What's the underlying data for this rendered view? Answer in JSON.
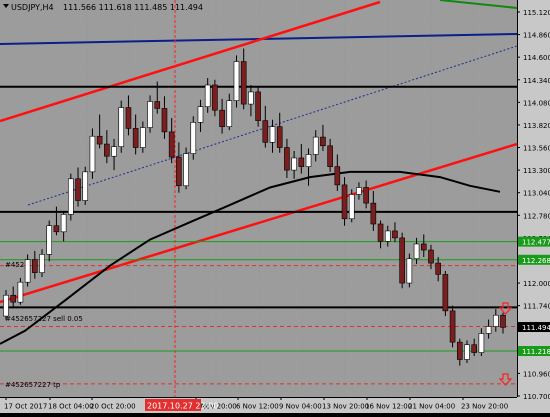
{
  "symbol": {
    "title": "USDJPY,H4",
    "ohlc": "111.566 111.618 111.485 111.494"
  },
  "price_axis": {
    "min": 110.7,
    "max": 115.12,
    "ticks": [
      "115.120",
      "114.860",
      "114.600",
      "114.340",
      "114.080",
      "113.820",
      "113.560",
      "113.300",
      "113.040",
      "112.780",
      "112.520",
      "112.260",
      "112.000",
      "111.740",
      "111.480",
      "111.220",
      "110.960",
      "110.700"
    ]
  },
  "time_axis": {
    "labels": [
      "17 Oct 2017",
      "18 Oct 04:00",
      "20 Oct 20:00",
      "1 Nov 20:00",
      "6 Nov 12:00",
      "9 Nov 04:00",
      "13 Nov 20:00",
      "16 Nov 12:00",
      "21 Nov 04:00",
      "23 Nov 20:00"
    ],
    "crosshair_label": "2017.10.27 23:00"
  },
  "price_tags": [
    {
      "text": "112.477",
      "value": 112.477,
      "color": "#1a9a1a"
    },
    {
      "text": "112.268",
      "value": 112.268,
      "color": "#1a9a1a"
    },
    {
      "text": "111.494",
      "value": 111.494,
      "color": "#000000"
    },
    {
      "text": "111.218",
      "value": 111.218,
      "color": "#1a9a1a"
    }
  ],
  "order_labels": [
    {
      "text": "#452",
      "value": 112.22
    },
    {
      "text": "#452657227 sell 0.05",
      "value": 111.6
    },
    {
      "text": "#452657227 tp",
      "value": 110.84
    }
  ],
  "chart_data": {
    "type": "candlestick",
    "title": "USDJPY,H4",
    "ylim": [
      110.7,
      115.12
    ],
    "horizontal_lines": {
      "black": [
        114.26,
        112.82,
        111.72
      ],
      "green": [
        112.477,
        112.268,
        111.218
      ],
      "red_dashed": [
        112.2,
        111.5,
        110.84
      ]
    },
    "moving_average_black": [
      [
        0,
        111.3
      ],
      [
        25,
        111.45
      ],
      [
        65,
        111.8
      ],
      [
        110,
        112.2
      ],
      [
        150,
        112.5
      ],
      [
        190,
        112.7
      ],
      [
        230,
        112.9
      ],
      [
        270,
        113.1
      ],
      [
        310,
        113.22
      ],
      [
        350,
        113.28
      ],
      [
        400,
        113.28
      ],
      [
        440,
        113.22
      ],
      [
        470,
        113.12
      ],
      [
        500,
        113.05
      ]
    ],
    "candles": [
      [
        111.62,
        111.92,
        111.58,
        111.86
      ],
      [
        111.86,
        111.96,
        111.72,
        111.78
      ],
      [
        111.78,
        112.06,
        111.75,
        112.01
      ],
      [
        112.01,
        112.33,
        111.96,
        112.27
      ],
      [
        112.27,
        112.37,
        112.05,
        112.12
      ],
      [
        112.12,
        112.39,
        112.07,
        112.33
      ],
      [
        112.33,
        112.72,
        112.25,
        112.66
      ],
      [
        112.66,
        112.88,
        112.55,
        112.59
      ],
      [
        112.59,
        112.83,
        112.48,
        112.79
      ],
      [
        112.79,
        113.26,
        112.72,
        113.2
      ],
      [
        113.2,
        113.33,
        112.88,
        112.95
      ],
      [
        112.95,
        113.34,
        112.9,
        113.28
      ],
      [
        113.28,
        113.78,
        113.2,
        113.69
      ],
      [
        113.69,
        113.94,
        113.55,
        113.6
      ],
      [
        113.6,
        113.76,
        113.38,
        113.46
      ],
      [
        113.46,
        113.66,
        113.3,
        113.57
      ],
      [
        113.57,
        114.1,
        113.5,
        114.02
      ],
      [
        114.02,
        114.16,
        113.7,
        113.78
      ],
      [
        113.78,
        113.94,
        113.48,
        113.56
      ],
      [
        113.56,
        113.86,
        113.5,
        113.79
      ],
      [
        113.79,
        114.16,
        113.73,
        114.09
      ],
      [
        114.09,
        114.32,
        113.95,
        114.01
      ],
      [
        114.01,
        114.15,
        113.66,
        113.74
      ],
      [
        113.74,
        113.9,
        113.38,
        113.45
      ],
      [
        113.45,
        113.62,
        113.04,
        113.12
      ],
      [
        113.12,
        113.56,
        113.08,
        113.49
      ],
      [
        113.49,
        113.92,
        113.42,
        113.85
      ],
      [
        113.85,
        114.11,
        113.74,
        114.03
      ],
      [
        114.03,
        114.36,
        113.96,
        114.28
      ],
      [
        114.28,
        114.34,
        113.92,
        113.99
      ],
      [
        113.99,
        114.12,
        113.72,
        113.8
      ],
      [
        113.8,
        114.18,
        113.76,
        114.1
      ],
      [
        114.1,
        114.62,
        114.02,
        114.55
      ],
      [
        114.55,
        114.7,
        114.0,
        114.06
      ],
      [
        114.06,
        114.28,
        113.92,
        114.2
      ],
      [
        114.2,
        114.26,
        113.8,
        113.87
      ],
      [
        113.87,
        114.04,
        113.56,
        113.62
      ],
      [
        113.62,
        113.88,
        113.5,
        113.8
      ],
      [
        113.8,
        113.96,
        113.5,
        113.56
      ],
      [
        113.56,
        113.66,
        113.21,
        113.3
      ],
      [
        113.3,
        113.52,
        113.2,
        113.44
      ],
      [
        113.44,
        113.6,
        113.26,
        113.34
      ],
      [
        113.34,
        113.55,
        113.12,
        113.48
      ],
      [
        113.48,
        113.76,
        113.4,
        113.68
      ],
      [
        113.68,
        113.82,
        113.52,
        113.58
      ],
      [
        113.58,
        113.66,
        113.28,
        113.34
      ],
      [
        113.34,
        113.48,
        113.06,
        113.13
      ],
      [
        113.13,
        113.22,
        112.66,
        112.74
      ],
      [
        112.74,
        113.08,
        112.7,
        113.02
      ],
      [
        113.02,
        113.16,
        112.96,
        113.1
      ],
      [
        113.1,
        113.18,
        112.86,
        112.92
      ],
      [
        112.92,
        113.06,
        112.6,
        112.68
      ],
      [
        112.68,
        112.72,
        112.4,
        112.48
      ],
      [
        112.48,
        112.66,
        112.42,
        112.6
      ],
      [
        112.6,
        112.7,
        112.47,
        112.52
      ],
      [
        112.52,
        112.58,
        111.94,
        112.0
      ],
      [
        112.0,
        112.34,
        111.95,
        112.28
      ],
      [
        112.28,
        112.52,
        112.22,
        112.45
      ],
      [
        112.45,
        112.56,
        112.3,
        112.38
      ],
      [
        112.38,
        112.44,
        112.16,
        112.23
      ],
      [
        112.23,
        112.3,
        112.02,
        112.1
      ],
      [
        112.1,
        112.14,
        111.62,
        111.68
      ],
      [
        111.68,
        111.74,
        111.26,
        111.32
      ],
      [
        111.32,
        111.36,
        111.05,
        111.12
      ],
      [
        111.12,
        111.34,
        111.08,
        111.29
      ],
      [
        111.29,
        111.36,
        111.16,
        111.2
      ],
      [
        111.2,
        111.48,
        111.16,
        111.42
      ],
      [
        111.42,
        111.58,
        111.36,
        111.5
      ],
      [
        111.5,
        111.7,
        111.44,
        111.63
      ],
      [
        111.63,
        111.66,
        111.42,
        111.49
      ]
    ],
    "up_color": "#ffffff",
    "down_color": "#7a1f1f",
    "background": "#9c9c9c"
  }
}
